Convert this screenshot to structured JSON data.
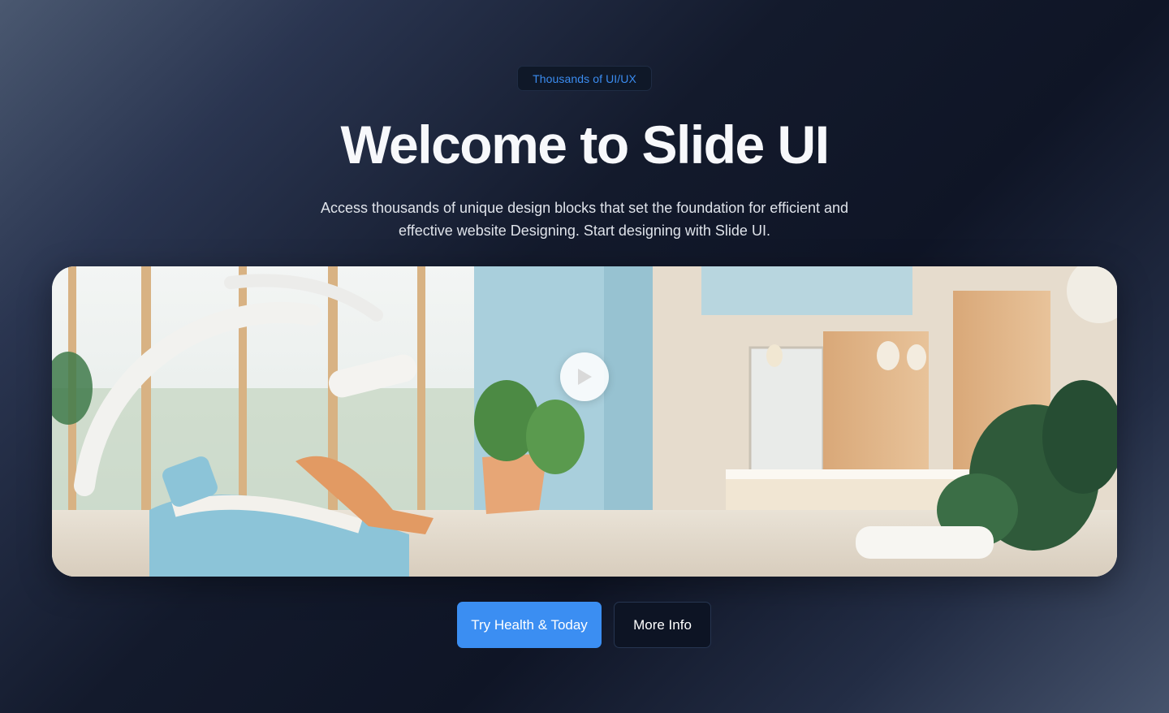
{
  "badge": {
    "label": "Thousands of UI/UX"
  },
  "hero": {
    "title": "Welcome to Slide UI",
    "description": "Access thousands of unique design blocks that set the foundation for efficient and effective website Designing. Start designing with Slide UI."
  },
  "media": {
    "play_icon": "play-icon"
  },
  "actions": {
    "primary_label": "Try Health & Today",
    "secondary_label": "More Info"
  },
  "colors": {
    "accent": "#3b8ef2",
    "badge_text": "#3b8cf0",
    "background_dark": "#0f1526"
  }
}
